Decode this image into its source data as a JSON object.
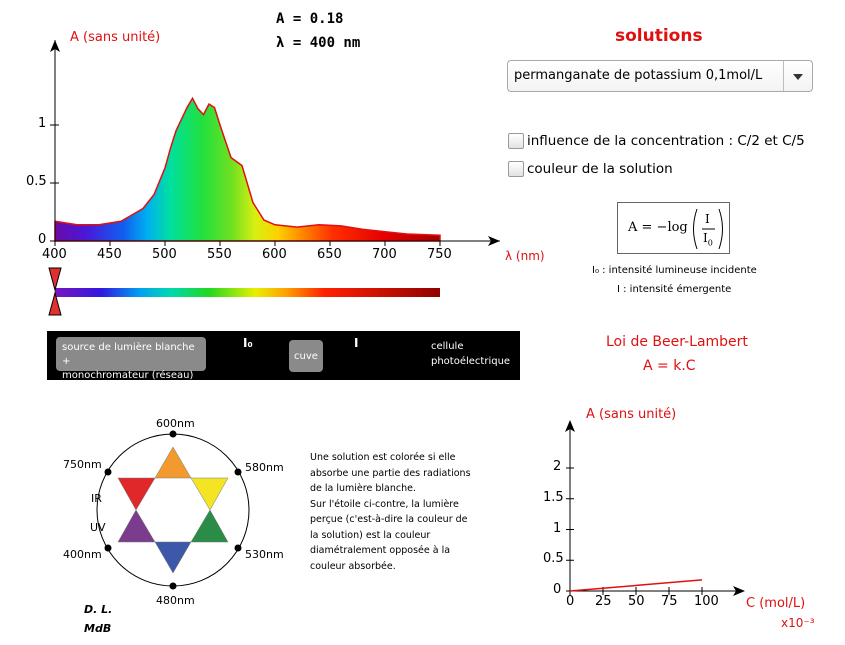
{
  "readout": {
    "absorbance": "A = 0.18",
    "wavelength": "λ = 400 nm"
  },
  "spectrum_chart": {
    "ylabel": "A (sans unité)",
    "xlabel": "λ (nm)",
    "y_ticks": [
      "0",
      "0.5",
      "1"
    ],
    "x_ticks": [
      "400",
      "450",
      "500",
      "550",
      "600",
      "650",
      "700",
      "750"
    ]
  },
  "solutions": {
    "title": "solutions",
    "selected": "permanganate de potassium 0,1mol/L",
    "options": [
      {
        "label": "influence de la concentration : C/2 et C/5",
        "checked": false
      },
      {
        "label": "couleur de la solution",
        "checked": false
      }
    ]
  },
  "formula": {
    "main": "A = −log",
    "numerator": "I",
    "denominator": "I",
    "denominator_sub": "0",
    "legend_i0": "I₀ : intensité lumineuse incidente",
    "legend_i": "I : intensité émergente"
  },
  "setup": {
    "source_line1": "source de lumière blanche +",
    "source_line2": "monochromateur (réseau)",
    "i0": "I₀",
    "i": "I",
    "cuve": "cuve",
    "cell_line1": "cellule",
    "cell_line2": "photoélectrique"
  },
  "beer_lambert": {
    "title": "Loi de Beer-Lambert",
    "formula": "A = k.C"
  },
  "star": {
    "labels": [
      "600nm",
      "580nm",
      "530nm",
      "480nm",
      "400nm",
      "750nm",
      "IR",
      "UV"
    ],
    "colors": [
      "#f39a2e",
      "#f4e524",
      "#2a8c46",
      "#3d58a8",
      "#7c3c8e",
      "#e0282a"
    ]
  },
  "note": [
    "Une solution est colorée si elle",
    "absorbe une partie des radiations",
    "de la lumière blanche.",
    "Sur l'étoile ci-contre, la lumière",
    "perçue (c'est-à-dire la couleur de",
    "la solution) est la couleur",
    "diamétralement opposée à la",
    "couleur absorbée."
  ],
  "author": {
    "line1": "D. L.",
    "line2": "MdB"
  },
  "chart_data": [
    {
      "type": "area",
      "title": "",
      "xlabel": "λ (nm)",
      "ylabel": "A (sans unité)",
      "xlim": [
        400,
        750
      ],
      "ylim": [
        0,
        1.2
      ],
      "grid": false,
      "series": [
        {
          "x": [
            400,
            420,
            440,
            460,
            480,
            490,
            500,
            505,
            510,
            520,
            525,
            530,
            535,
            540,
            545,
            550,
            560,
            570,
            580,
            590,
            600,
            620,
            640,
            660,
            680,
            700,
            720,
            750
          ],
          "y": [
            0.17,
            0.14,
            0.14,
            0.17,
            0.28,
            0.4,
            0.63,
            0.8,
            0.95,
            1.15,
            1.23,
            1.14,
            1.09,
            1.18,
            1.15,
            1.0,
            0.72,
            0.65,
            0.33,
            0.18,
            0.14,
            0.12,
            0.14,
            0.13,
            0.1,
            0.08,
            0.06,
            0.05
          ]
        }
      ]
    },
    {
      "type": "line",
      "title": "",
      "xlabel": "C (mol/L)",
      "x_multiplier": "x10⁻³",
      "ylabel": "A (sans unité)",
      "xlim": [
        0,
        110
      ],
      "ylim": [
        0,
        2.3
      ],
      "x_ticks": [
        "0",
        "25",
        "50",
        "75",
        "100"
      ],
      "y_ticks": [
        "0",
        "0.5",
        "1",
        "1.5",
        "2"
      ],
      "series": [
        {
          "x": [
            0,
            100
          ],
          "y": [
            0,
            0.18
          ]
        }
      ]
    }
  ]
}
